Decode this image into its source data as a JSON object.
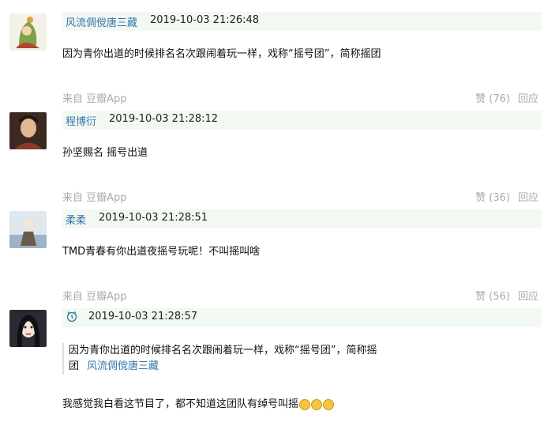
{
  "comments": [
    {
      "author": "风流倜傥唐三藏",
      "time": "2019-10-03 21:26:48",
      "text": "因为青你出道的时候排名名次跟闹着玩一样，戏称“摇号团”，简称摇团"
    },
    {
      "author": "程博衍",
      "time": "2019-10-03 21:28:12",
      "text": "孙坚赐名 摇号出道"
    },
    {
      "author": "柔柔",
      "time": "2019-10-03 21:28:51",
      "text": "TMD青春有你出道夜摇号玩呢！不叫摇叫啥"
    },
    {
      "author": "",
      "time": "2019-10-03 21:28:57",
      "quote": {
        "line1": "因为青你出道的时候排名名次跟闹着玩一样，戏称“摇号团”，简称摇",
        "line2": "团",
        "author": "风流倜傥唐三藏"
      },
      "text": "我感觉我白看这节目了，都不知道这团队有绰号叫摇"
    }
  ],
  "footers": [
    {
      "source": "来自 豆瓣App",
      "vote": "赞 (76)",
      "reply": "回应"
    },
    {
      "source": "来自 豆瓣App",
      "vote": "赞 (36)",
      "reply": "回应"
    },
    {
      "source": "来自 豆瓣App",
      "vote": "赞 (56)",
      "reply": "回应"
    }
  ]
}
